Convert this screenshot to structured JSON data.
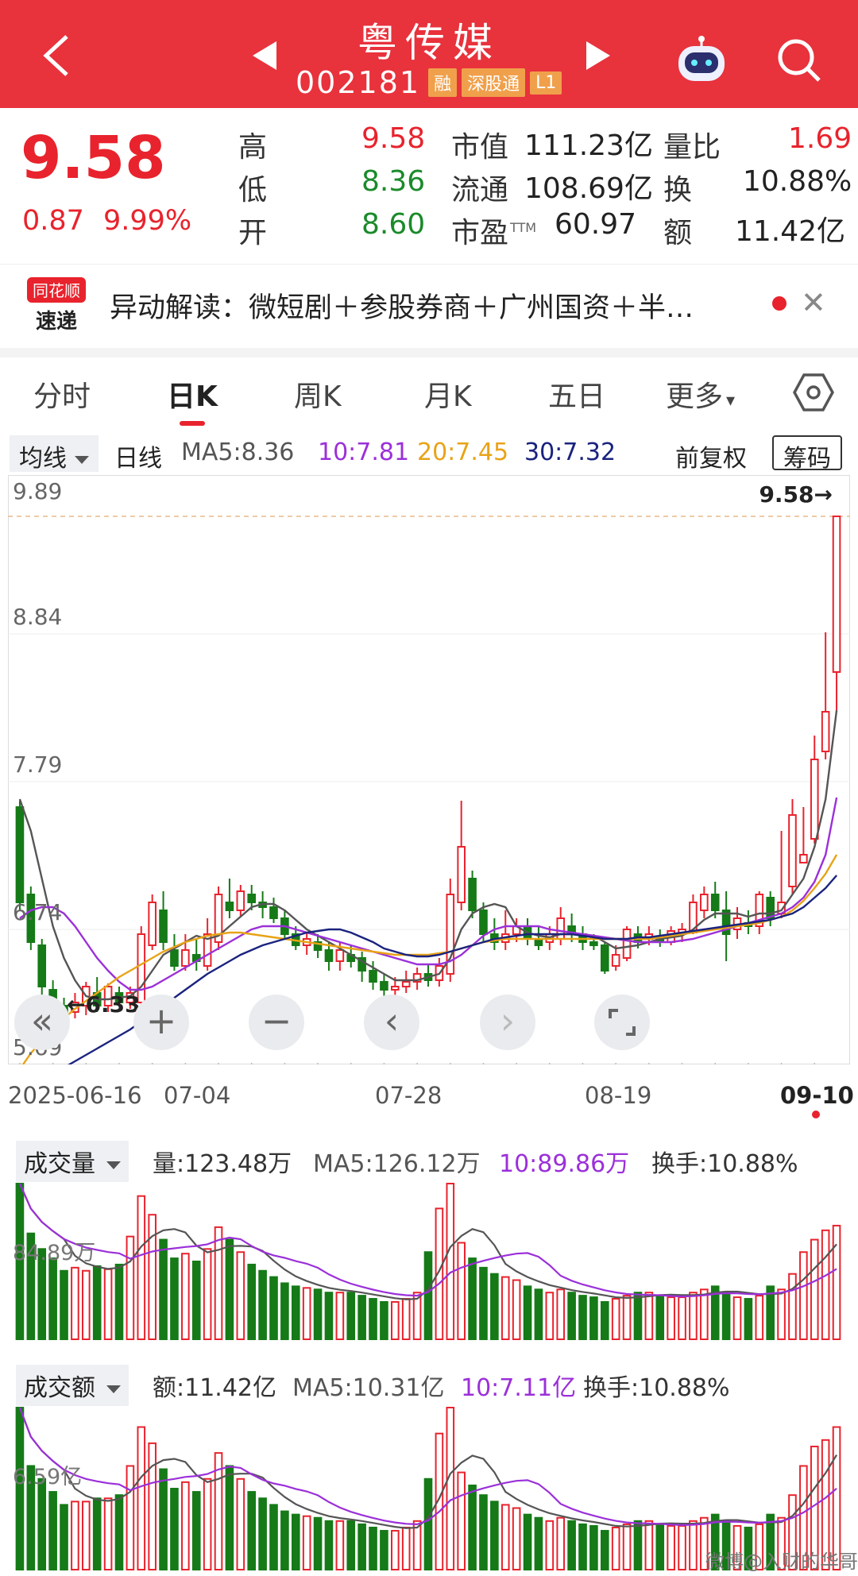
{
  "header": {
    "title": "粤传媒",
    "code": "002181",
    "tags": [
      "融",
      "深股通",
      "L1"
    ]
  },
  "quote": {
    "price": "9.58",
    "change": "0.87",
    "change_pct": "9.99%",
    "high_label": "高",
    "high": "9.58",
    "low_label": "低",
    "low": "8.36",
    "open_label": "开",
    "open": "8.60",
    "mktcap_label": "市值",
    "mktcap": "111.23亿",
    "float_label": "流通",
    "float": "108.69亿",
    "pe_label": "市盈",
    "pe_sup": "TTM",
    "pe": "60.97",
    "vol_ratio_label": "量比",
    "vol_ratio": "1.69",
    "turnover_label": "换",
    "turnover": "10.88%",
    "amount_label": "额",
    "amount": "11.42亿"
  },
  "news": {
    "logo_top": "同花顺",
    "logo_bottom": "速递",
    "text": "异动解读：微短剧＋参股券商＋广州国资＋半…"
  },
  "tabs": [
    "分时",
    "日K",
    "周K",
    "月K",
    "五日",
    "更多"
  ],
  "ma_row": {
    "selector": "均线",
    "period": "日线",
    "ma5": "MA5:8.36",
    "ma10": "10:7.81",
    "ma20": "20:7.45",
    "ma30": "30:7.32",
    "adjust": "前复权",
    "chip": "筹码"
  },
  "chart_labels": {
    "y_top": "9.89",
    "y_2": "8.84",
    "y_3": "7.79",
    "y_4": "6.74",
    "y_bottom": "5.69",
    "max_marker": "9.58→",
    "min_marker": "←6.33"
  },
  "dates": [
    "2025-06-16",
    "07-04",
    "07-28",
    "08-19",
    "09-10"
  ],
  "controls": [
    "«",
    "+",
    "−",
    "‹",
    "›"
  ],
  "volume": {
    "selector": "成交量",
    "value": "量:123.48万",
    "ma5": "MA5:126.12万",
    "ma10": "10:89.86万",
    "turnover": "换手:10.88%",
    "axis": "84.89万"
  },
  "amount": {
    "selector": "成交额",
    "value": "额:11.42亿",
    "ma5": "MA5:10.31亿",
    "ma10": "10:7.11亿",
    "turnover": "换手:10.88%",
    "axis": "6.59亿"
  },
  "watermark": "微博@入财的华哥",
  "colors": {
    "up": "#e8232d",
    "down": "#157a17",
    "ma5": "#555555",
    "ma10": "#9b30d9",
    "ma20": "#e8a317",
    "ma30": "#1a237e",
    "header": "#e8323c"
  },
  "chart_data": {
    "type": "candlestick",
    "ylim": [
      5.69,
      9.89
    ],
    "candles": [
      [
        7.75,
        7.15,
        7.79,
        7.1
      ],
      [
        7.2,
        6.9,
        7.25,
        6.85
      ],
      [
        6.88,
        6.62,
        6.92,
        6.55
      ],
      [
        6.6,
        6.52,
        6.66,
        6.45
      ],
      [
        6.5,
        6.45,
        6.55,
        6.4
      ],
      [
        6.46,
        6.52,
        6.58,
        6.42
      ],
      [
        6.5,
        6.62,
        6.65,
        6.44
      ],
      [
        6.58,
        6.5,
        6.68,
        6.46
      ],
      [
        6.5,
        6.62,
        6.64,
        6.46
      ],
      [
        6.58,
        6.52,
        6.62,
        6.5
      ],
      [
        6.52,
        6.58,
        6.62,
        6.48
      ],
      [
        6.52,
        6.95,
        7.0,
        6.5
      ],
      [
        6.88,
        7.15,
        7.2,
        6.85
      ],
      [
        7.1,
        6.9,
        7.22,
        6.85
      ],
      [
        6.85,
        6.75,
        6.95,
        6.72
      ],
      [
        6.75,
        6.85,
        6.95,
        6.72
      ],
      [
        6.82,
        6.78,
        6.92,
        6.72
      ],
      [
        6.75,
        6.95,
        7.05,
        6.72
      ],
      [
        6.9,
        7.2,
        7.25,
        6.85
      ],
      [
        7.15,
        7.1,
        7.3,
        7.05
      ],
      [
        7.1,
        7.22,
        7.26,
        7.06
      ],
      [
        7.2,
        7.15,
        7.26,
        7.1
      ],
      [
        7.15,
        7.12,
        7.22,
        7.05
      ],
      [
        7.12,
        7.05,
        7.18,
        7.02
      ],
      [
        7.05,
        6.95,
        7.1,
        6.92
      ],
      [
        6.95,
        6.88,
        7.0,
        6.85
      ],
      [
        6.88,
        6.92,
        6.96,
        6.82
      ],
      [
        6.9,
        6.85,
        6.95,
        6.8
      ],
      [
        6.85,
        6.78,
        6.9,
        6.72
      ],
      [
        6.78,
        6.85,
        6.9,
        6.72
      ],
      [
        6.82,
        6.78,
        6.88,
        6.74
      ],
      [
        6.8,
        6.72,
        6.84,
        6.65
      ],
      [
        6.72,
        6.65,
        6.78,
        6.6
      ],
      [
        6.65,
        6.6,
        6.7,
        6.55
      ],
      [
        6.6,
        6.62,
        6.68,
        6.55
      ],
      [
        6.62,
        6.65,
        6.72,
        6.58
      ],
      [
        6.65,
        6.7,
        6.74,
        6.6
      ],
      [
        6.7,
        6.66,
        6.76,
        6.62
      ],
      [
        6.66,
        6.75,
        6.8,
        6.62
      ],
      [
        6.7,
        7.2,
        7.3,
        6.65
      ],
      [
        7.15,
        7.5,
        7.79,
        7.1
      ],
      [
        7.3,
        7.1,
        7.35,
        7.05
      ],
      [
        7.1,
        6.95,
        7.15,
        6.9
      ],
      [
        6.95,
        6.9,
        7.05,
        6.85
      ],
      [
        6.9,
        6.95,
        7.1,
        6.85
      ],
      [
        6.95,
        7.0,
        7.05,
        6.9
      ],
      [
        7.0,
        6.92,
        7.05,
        6.88
      ],
      [
        6.92,
        6.88,
        7.0,
        6.85
      ],
      [
        6.9,
        6.95,
        7.0,
        6.85
      ],
      [
        6.92,
        7.05,
        7.12,
        6.88
      ],
      [
        7.0,
        6.95,
        7.08,
        6.9
      ],
      [
        6.95,
        6.9,
        7.0,
        6.85
      ],
      [
        6.9,
        6.88,
        6.95,
        6.85
      ],
      [
        6.88,
        6.72,
        6.9,
        6.7
      ],
      [
        6.75,
        6.82,
        6.88,
        6.72
      ],
      [
        6.8,
        6.98,
        7.0,
        6.78
      ],
      [
        6.95,
        6.9,
        7.0,
        6.86
      ],
      [
        6.92,
        6.95,
        7.0,
        6.88
      ],
      [
        6.93,
        6.9,
        6.98,
        6.87
      ],
      [
        6.9,
        6.97,
        7.0,
        6.88
      ],
      [
        6.95,
        6.98,
        7.02,
        6.9
      ],
      [
        6.96,
        7.15,
        7.2,
        6.95
      ],
      [
        7.1,
        7.2,
        7.25,
        7.05
      ],
      [
        7.2,
        7.1,
        7.28,
        7.05
      ],
      [
        7.1,
        6.95,
        7.22,
        6.78
      ],
      [
        6.98,
        7.05,
        7.12,
        6.92
      ],
      [
        7.02,
        7.0,
        7.1,
        6.95
      ],
      [
        7.0,
        7.2,
        7.22,
        6.95
      ],
      [
        7.18,
        7.05,
        7.22,
        7.0
      ],
      [
        7.08,
        7.15,
        7.6,
        7.05
      ],
      [
        7.25,
        7.7,
        7.8,
        7.2
      ],
      [
        7.4,
        7.45,
        7.75,
        7.4
      ],
      [
        7.55,
        8.05,
        8.2,
        7.52
      ],
      [
        8.1,
        8.35,
        8.85,
        8.05
      ],
      [
        8.6,
        9.58,
        9.58,
        8.36
      ]
    ],
    "ma_series": [
      {
        "name": "MA5",
        "values": [
          7.8,
          7.6,
          7.3,
          7.0,
          6.8,
          6.66,
          6.56,
          6.54,
          6.54,
          6.55,
          6.56,
          6.62,
          6.72,
          6.82,
          6.86,
          6.9,
          6.94,
          6.92,
          6.94,
          7.0,
          7.06,
          7.12,
          7.14,
          7.14,
          7.1,
          7.04,
          6.98,
          6.94,
          6.9,
          6.86,
          6.82,
          6.78,
          6.74,
          6.7,
          6.66,
          6.66,
          6.66,
          6.68,
          6.7,
          6.8,
          6.98,
          7.08,
          7.12,
          7.14,
          7.12,
          7.0,
          6.96,
          6.94,
          6.93,
          6.95,
          6.95,
          6.95,
          6.94,
          6.9,
          6.86,
          6.87,
          6.88,
          6.9,
          6.92,
          6.93,
          6.94,
          6.98,
          7.04,
          7.08,
          7.08,
          7.08,
          7.06,
          7.08,
          7.08,
          7.1,
          7.2,
          7.3,
          7.5,
          7.8,
          8.36
        ]
      },
      {
        "name": "MA10",
        "values": [
          7.05,
          7.1,
          7.12,
          7.12,
          7.08,
          7.0,
          6.9,
          6.8,
          6.72,
          6.65,
          6.6,
          6.6,
          6.62,
          6.66,
          6.7,
          6.74,
          6.78,
          6.82,
          6.86,
          6.9,
          6.94,
          6.98,
          7.0,
          7.0,
          7.0,
          6.98,
          6.96,
          6.94,
          6.92,
          6.9,
          6.88,
          6.86,
          6.84,
          6.82,
          6.8,
          6.78,
          6.76,
          6.76,
          6.76,
          6.78,
          6.82,
          6.88,
          6.94,
          6.98,
          7.0,
          7.0,
          7.0,
          7.0,
          6.98,
          6.97,
          6.96,
          6.95,
          6.94,
          6.93,
          6.92,
          6.91,
          6.9,
          6.9,
          6.9,
          6.9,
          6.91,
          6.92,
          6.94,
          6.96,
          6.98,
          7.0,
          7.02,
          7.04,
          7.06,
          7.08,
          7.12,
          7.18,
          7.28,
          7.45,
          7.81
        ]
      },
      {
        "name": "MA20",
        "values": [
          6.1,
          6.2,
          6.28,
          6.36,
          6.42,
          6.48,
          6.53,
          6.58,
          6.63,
          6.68,
          6.72,
          6.76,
          6.8,
          6.84,
          6.87,
          6.9,
          6.92,
          6.94,
          6.95,
          6.96,
          6.96,
          6.95,
          6.94,
          6.93,
          6.92,
          6.91,
          6.9,
          6.89,
          6.88,
          6.87,
          6.86,
          6.85,
          6.84,
          6.83,
          6.82,
          6.82,
          6.82,
          6.82,
          6.83,
          6.84,
          6.86,
          6.88,
          6.9,
          6.91,
          6.92,
          6.92,
          6.92,
          6.92,
          6.92,
          6.92,
          6.92,
          6.92,
          6.92,
          6.92,
          6.92,
          6.92,
          6.92,
          6.92,
          6.93,
          6.94,
          6.95,
          6.96,
          6.97,
          6.98,
          6.99,
          7.0,
          7.01,
          7.02,
          7.04,
          7.06,
          7.1,
          7.16,
          7.24,
          7.33,
          7.45
        ]
      },
      {
        "name": "MA30",
        "values": [
          5.95,
          5.99,
          6.03,
          6.07,
          6.11,
          6.15,
          6.19,
          6.23,
          6.27,
          6.31,
          6.35,
          6.4,
          6.45,
          6.5,
          6.55,
          6.6,
          6.65,
          6.7,
          6.74,
          6.78,
          6.82,
          6.85,
          6.88,
          6.9,
          6.92,
          6.94,
          6.96,
          6.97,
          6.98,
          6.98,
          6.96,
          6.93,
          6.9,
          6.86,
          6.84,
          6.82,
          6.81,
          6.81,
          6.82,
          6.84,
          6.86,
          6.88,
          6.9,
          6.92,
          6.93,
          6.94,
          6.95,
          6.95,
          6.95,
          6.95,
          6.95,
          6.94,
          6.93,
          6.92,
          6.92,
          6.92,
          6.93,
          6.93,
          6.94,
          6.95,
          6.96,
          6.97,
          6.98,
          6.99,
          7.0,
          7.01,
          7.02,
          7.03,
          7.04,
          7.06,
          7.08,
          7.12,
          7.18,
          7.24,
          7.32
        ]
      }
    ],
    "volume": [
      100,
      68,
      58,
      52,
      44,
      46,
      44,
      47,
      45,
      48,
      66,
      92,
      80,
      64,
      52,
      55,
      50,
      58,
      72,
      64,
      56,
      48,
      44,
      40,
      36,
      34,
      33,
      32,
      30,
      30,
      30,
      28,
      26,
      24,
      24,
      26,
      30,
      56,
      84,
      100,
      62,
      52,
      46,
      42,
      40,
      38,
      34,
      32,
      30,
      32,
      30,
      28,
      27,
      24,
      26,
      28,
      30,
      30,
      28,
      27,
      27,
      30,
      32,
      34,
      30,
      27,
      26,
      28,
      34,
      32,
      42,
      56,
      64,
      70,
      73
    ],
    "amount": [
      100,
      64,
      56,
      48,
      40,
      42,
      42,
      44,
      44,
      46,
      64,
      88,
      78,
      62,
      50,
      54,
      48,
      56,
      72,
      64,
      56,
      48,
      44,
      40,
      36,
      34,
      33,
      32,
      30,
      30,
      30,
      28,
      26,
      24,
      24,
      26,
      30,
      56,
      84,
      100,
      60,
      52,
      46,
      42,
      40,
      38,
      34,
      32,
      30,
      32,
      30,
      28,
      27,
      24,
      26,
      28,
      30,
      30,
      28,
      27,
      27,
      30,
      32,
      34,
      30,
      27,
      26,
      28,
      34,
      32,
      46,
      64,
      76,
      80,
      88
    ]
  }
}
